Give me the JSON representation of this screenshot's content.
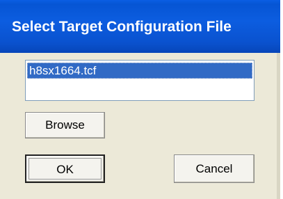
{
  "dialog": {
    "title": "Select Target Configuration File",
    "file_list": {
      "items": [
        "h8sx1664.tcf"
      ],
      "selected_index": 0
    },
    "buttons": {
      "browse_label": "Browse",
      "ok_label": "OK",
      "cancel_label": "Cancel"
    }
  },
  "colors": {
    "titlebar": "#0a55d4",
    "selection": "#316ac5",
    "dialog_background": "#ece9d8"
  }
}
